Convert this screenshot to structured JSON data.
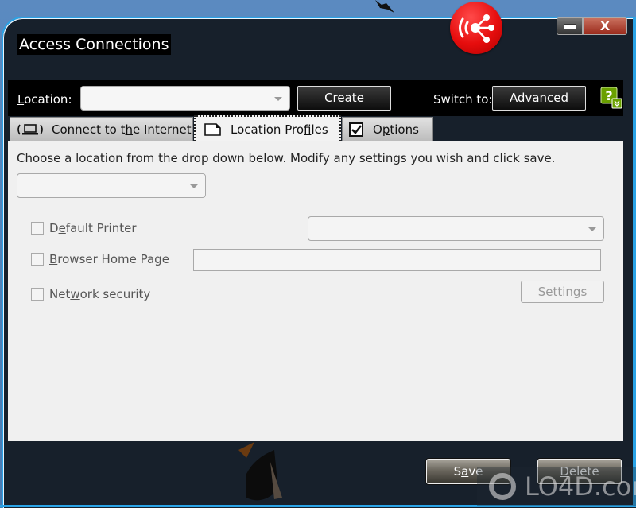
{
  "window": {
    "title": "Access Connections",
    "minimize_label": "—",
    "close_label": "X"
  },
  "toolbar": {
    "location_label_pre": "",
    "location_label_accel": "L",
    "location_label_post": "ocation:",
    "location_value": "",
    "create_pre": "C",
    "create_accel": "r",
    "create_post": "eate",
    "switch_label": "Switch to:",
    "advanced_pre": "Ad",
    "advanced_accel": "v",
    "advanced_post": "anced"
  },
  "tabs": [
    {
      "pre": "Connect to t",
      "accel": "h",
      "post": "e Internet",
      "icon": "laptop-wireless-icon",
      "active": false
    },
    {
      "pre": "Location Pro",
      "accel": "f",
      "post": "iles",
      "icon": "document-icon",
      "active": true
    },
    {
      "pre": "O",
      "accel": "p",
      "post": "tions",
      "icon": "checkbox-checked-icon",
      "active": false
    }
  ],
  "profiles": {
    "instruction": "Choose a location from the drop down below. Modify any settings you wish and click save.",
    "profile_value": "",
    "settings": [
      {
        "pre": "D",
        "accel": "e",
        "post": "fault Printer",
        "checked": false,
        "value": ""
      },
      {
        "pre": "",
        "accel": "B",
        "post": "rowser Home Page",
        "checked": false,
        "value": ""
      },
      {
        "pre": "Net",
        "accel": "w",
        "post": "ork security",
        "checked": false
      }
    ],
    "settings_button": "Settings"
  },
  "footer": {
    "save_pre": "S",
    "save_accel": "a",
    "save_post": "ve",
    "delete_pre": "",
    "delete_accel": "D",
    "delete_post": "elete"
  },
  "watermark": "LO4D.com",
  "colors": {
    "accent": "#2aa3e6",
    "window_bg": "#17202b",
    "logo_red": "#e60d0d",
    "help_green": "#6aa000"
  }
}
